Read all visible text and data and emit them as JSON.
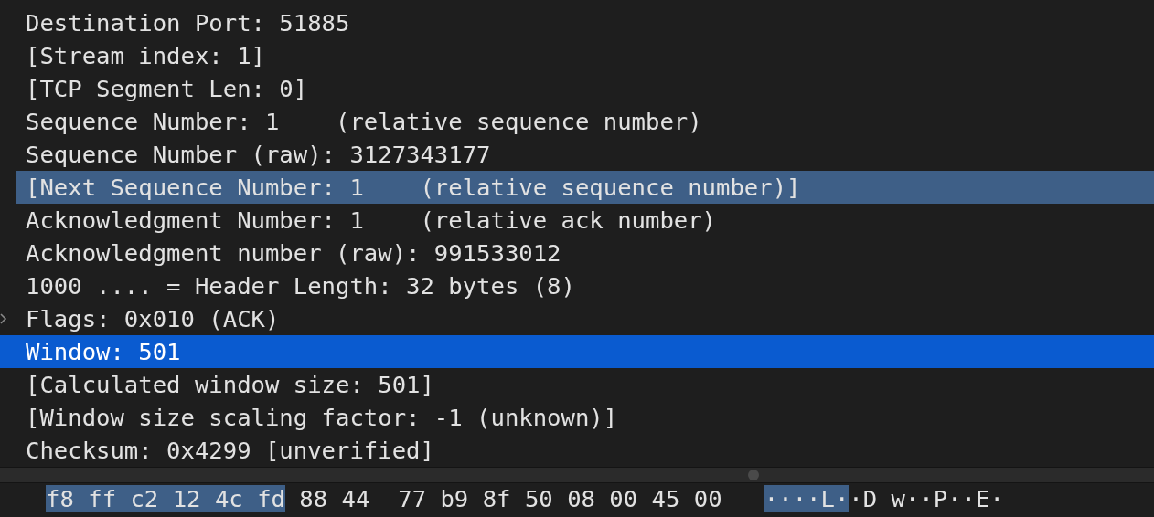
{
  "details": [
    {
      "text": "Destination Port: 51885",
      "selected": false,
      "related": false
    },
    {
      "text": "[Stream index: 1]",
      "selected": false,
      "related": false
    },
    {
      "text": "[TCP Segment Len: 0]",
      "selected": false,
      "related": false
    },
    {
      "text": "Sequence Number: 1    (relative sequence number)",
      "selected": false,
      "related": false
    },
    {
      "text": "Sequence Number (raw): 3127343177",
      "selected": false,
      "related": false
    },
    {
      "text": "[Next Sequence Number: 1    (relative sequence number)]",
      "selected": false,
      "related": true
    },
    {
      "text": "Acknowledgment Number: 1    (relative ack number)",
      "selected": false,
      "related": false
    },
    {
      "text": "Acknowledgment number (raw): 991533012",
      "selected": false,
      "related": false
    },
    {
      "text": "1000 .... = Header Length: 32 bytes (8)",
      "selected": false,
      "related": false
    },
    {
      "text": "Flags: 0x010 (ACK)",
      "selected": false,
      "related": false,
      "expanded": false
    },
    {
      "text": "Window: 501",
      "selected": true,
      "related": false
    },
    {
      "text": "[Calculated window size: 501]",
      "selected": false,
      "related": false
    },
    {
      "text": "[Window size scaling factor: -1 (unknown)]",
      "selected": false,
      "related": false
    },
    {
      "text": "Checksum: 0x4299 [unverified]",
      "selected": false,
      "related": false
    }
  ],
  "hex_dump": {
    "bytes": [
      {
        "text": "f8 ff c2 12 4c fd",
        "highlighted": true
      },
      {
        "text": "88 44  77 b9 8f 50 08 00 45 00",
        "highlighted": false
      }
    ],
    "ascii": [
      {
        "text": "····L·",
        "highlighted": true
      },
      {
        "text": "·D w··P··E·",
        "highlighted": false
      }
    ]
  }
}
